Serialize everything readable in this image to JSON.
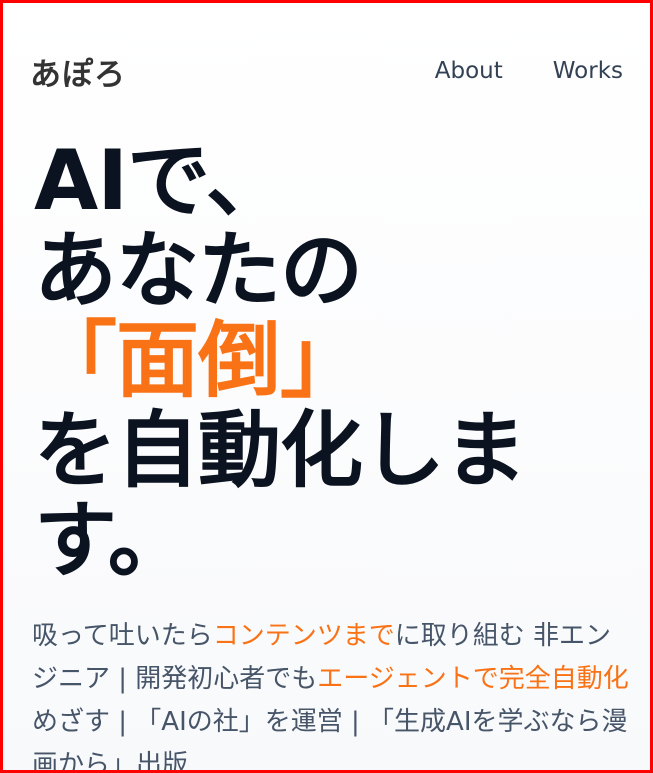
{
  "header": {
    "logo": "あぽろ",
    "nav": [
      {
        "label": "About"
      },
      {
        "label": "Works"
      }
    ]
  },
  "hero": {
    "line1": "AIで、",
    "line2": "あなたの",
    "line3": "「面倒」",
    "line4": "を自動化しま",
    "line5": "す。"
  },
  "intro": {
    "part1": "吸って吐いたら",
    "part2": "コンテンツまで",
    "part3": "に取り組む 非エンジニア | 開発初心者でも",
    "part4": "エージェントで完全自動化",
    "part5": "めざす | 「AIの社」を運営 | 「生成AIを学ぶなら漫画から」出版"
  },
  "colors": {
    "accent": "#f97316",
    "heading": "#0b1220",
    "body": "#475569",
    "frame": "#ff0000"
  }
}
